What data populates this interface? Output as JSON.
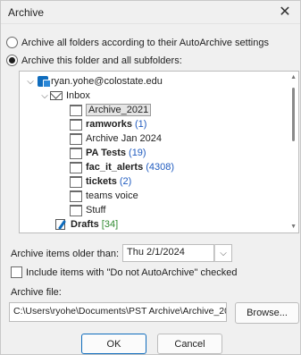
{
  "window": {
    "title": "Archive"
  },
  "options": {
    "archive_all_label": "Archive all folders according to their AutoArchive settings",
    "archive_this_label": "Archive this folder and all subfolders:"
  },
  "tree": {
    "account": "ryan.yohe@colostate.edu",
    "inbox": "Inbox",
    "folders": [
      {
        "name": "Archive_2021",
        "count": "",
        "bold": false,
        "selected": true
      },
      {
        "name": "ramworks",
        "count": "(1)",
        "bold": true
      },
      {
        "name": "Archive Jan 2024",
        "count": "",
        "bold": false
      },
      {
        "name": "PA Tests",
        "count": "(19)",
        "bold": true
      },
      {
        "name": "fac_it_alerts",
        "count": "(4308)",
        "bold": true
      },
      {
        "name": "tickets",
        "count": "(2)",
        "bold": true
      },
      {
        "name": "teams voice",
        "count": "",
        "bold": false
      },
      {
        "name": "Stuff",
        "count": "",
        "bold": false
      }
    ],
    "drafts": "Drafts",
    "drafts_count": "[34]"
  },
  "archive_older": {
    "label": "Archive items older than:",
    "value": "Thu 2/1/2024"
  },
  "include_checkbox": {
    "label": "Include items with \"Do not AutoArchive\" checked"
  },
  "archive_file": {
    "label": "Archive file:",
    "value": "C:\\Users\\ryohe\\Documents\\PST Archive\\Archive_20",
    "browse_label": "Browse..."
  },
  "buttons": {
    "ok": "OK",
    "cancel": "Cancel"
  },
  "icons": {
    "close": "close-icon",
    "chevron": "chevron-down-icon",
    "account": "outlook-account-icon",
    "inbox": "envelope-icon",
    "folder": "folder-icon",
    "drafts": "drafts-icon"
  },
  "colors": {
    "accent": "#0f6cbd",
    "count_blue": "#1f5bbf",
    "count_green": "#2f8a2f"
  }
}
